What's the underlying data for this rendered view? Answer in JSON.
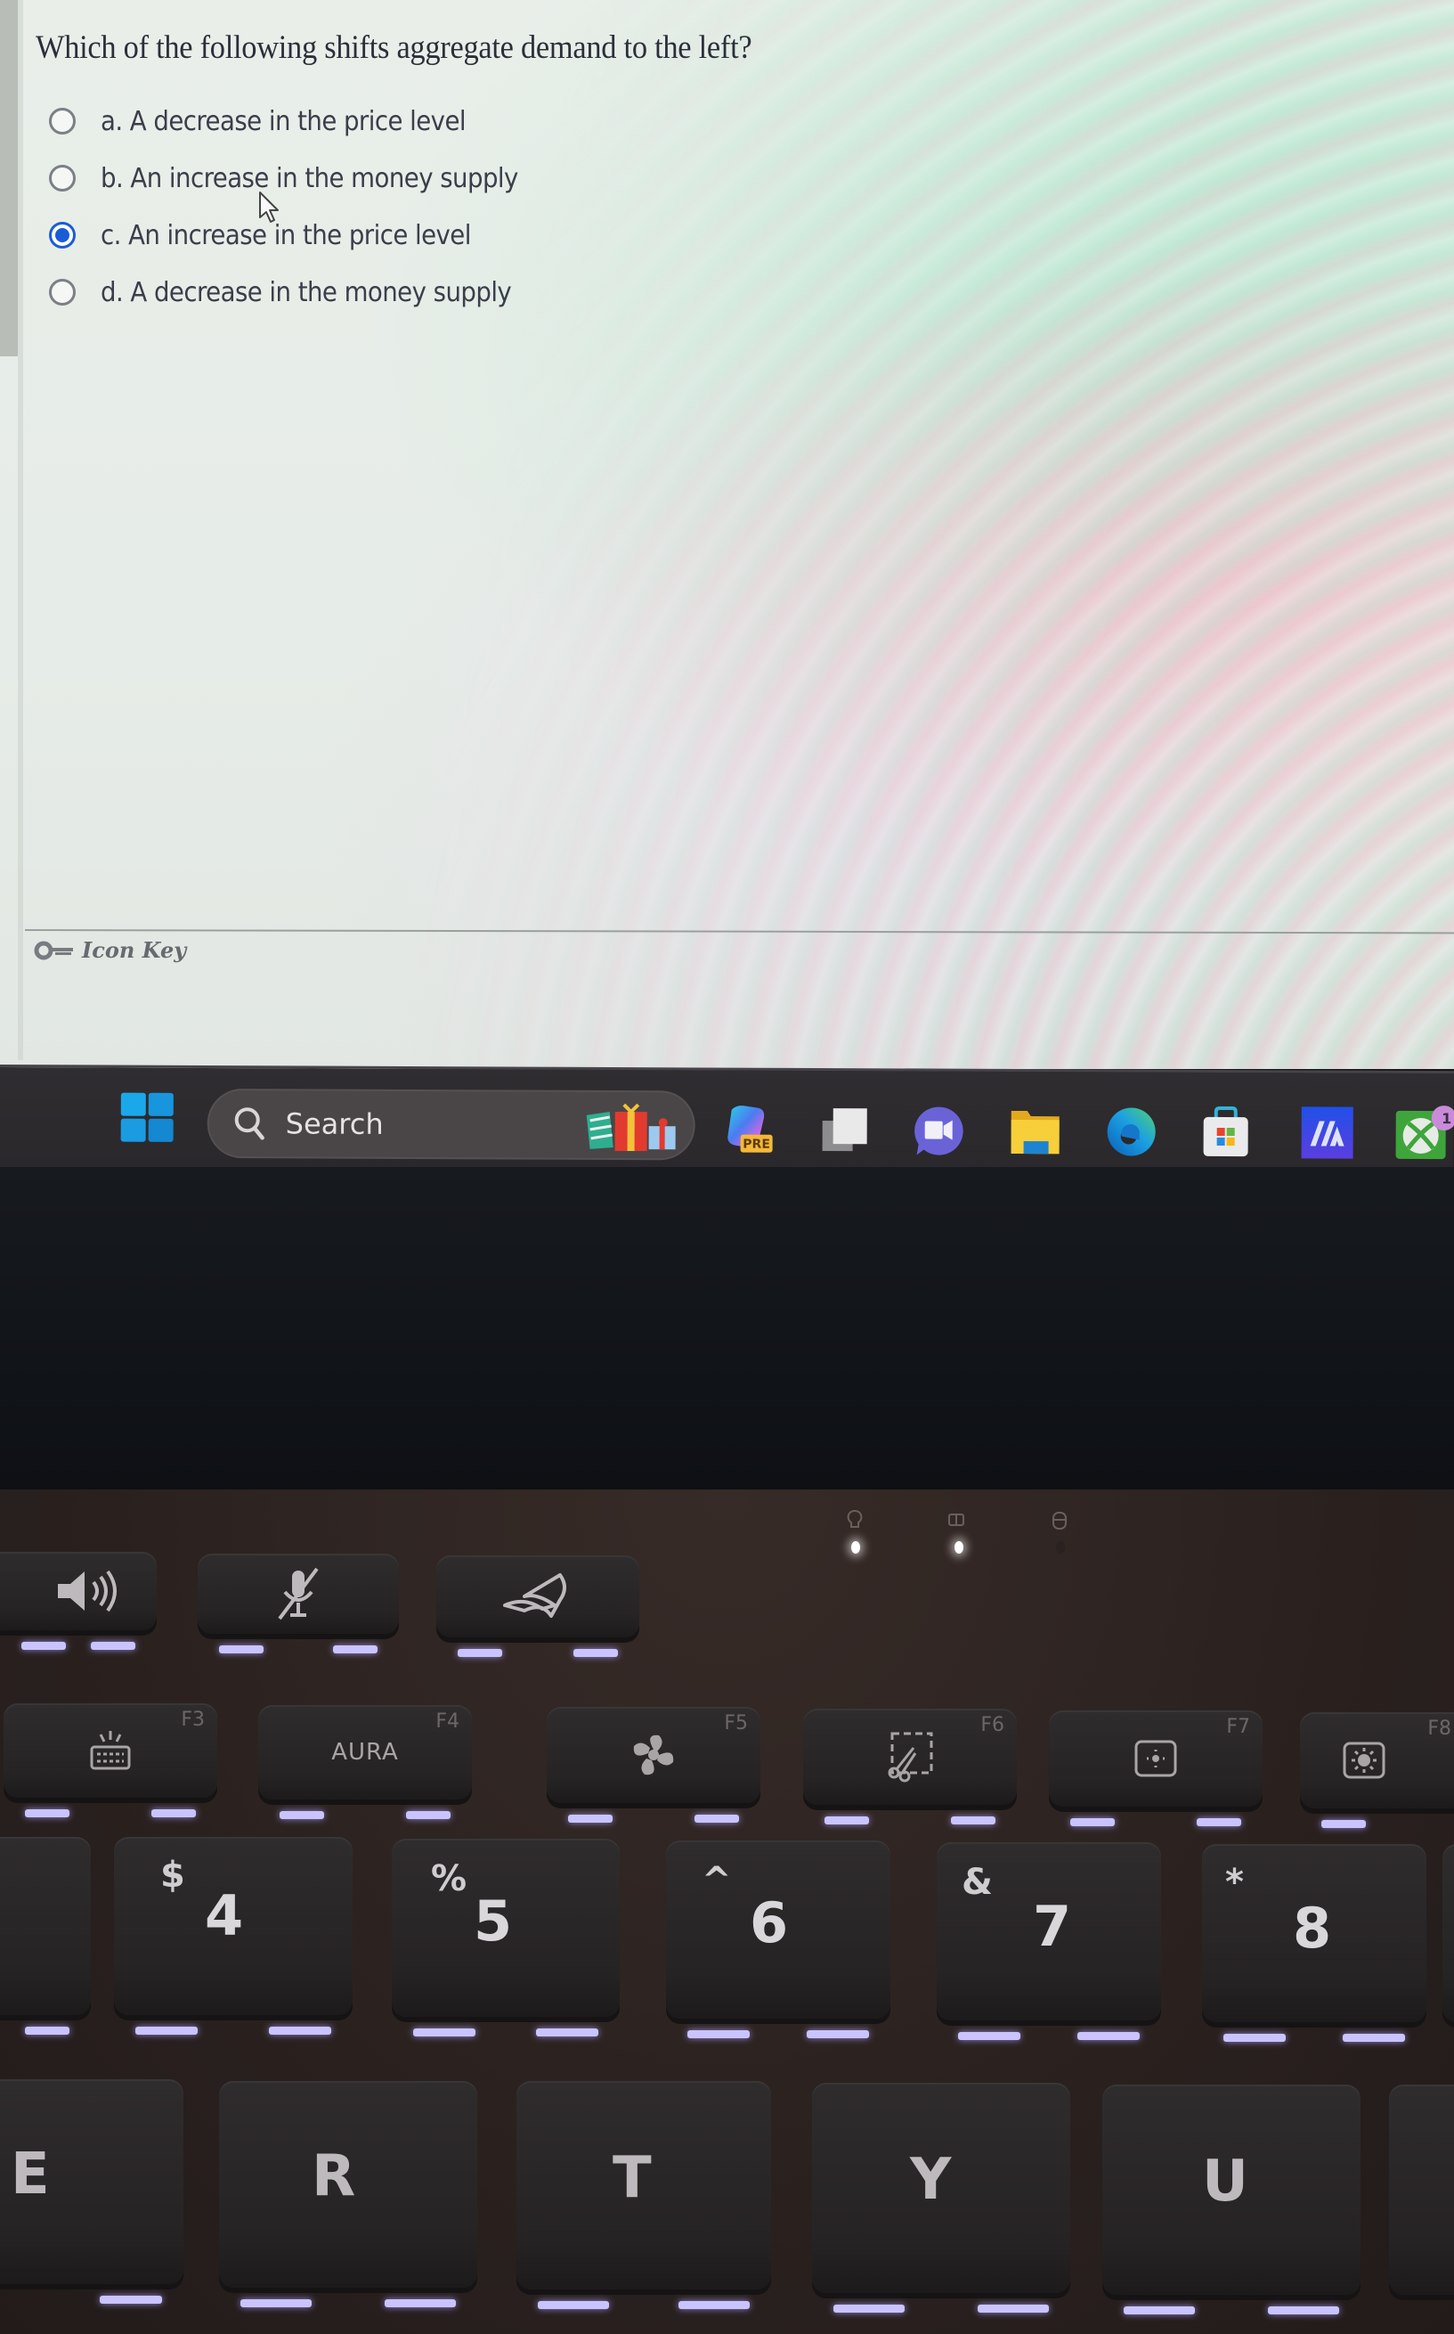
{
  "quiz": {
    "question": "Which of the following shifts aggregate demand to the left?",
    "options": [
      {
        "id": "a",
        "label": "a. A decrease in the price level",
        "selected": false
      },
      {
        "id": "b",
        "label": "b. An increase in the money supply",
        "selected": false
      },
      {
        "id": "c",
        "label": "c. An increase in the price level",
        "selected": true
      },
      {
        "id": "d",
        "label": "d. A decrease in the money supply",
        "selected": false
      }
    ],
    "selected_option": "c",
    "icon_key_label": "Icon Key"
  },
  "taskbar": {
    "start_icon": "windows-start-icon",
    "search_placeholder": "Search",
    "search_icon": "search-icon",
    "search_highlight_icon": "gift-icon",
    "pinned_apps": [
      {
        "name": "copilot-pre",
        "icon": "copilot-icon",
        "badge_text": "PRE"
      },
      {
        "name": "task-view",
        "icon": "task-view-icon"
      },
      {
        "name": "meet",
        "icon": "video-chat-icon"
      },
      {
        "name": "file-explorer",
        "icon": "folder-icon"
      },
      {
        "name": "edge",
        "icon": "edge-browser-icon"
      },
      {
        "name": "microsoft-store",
        "icon": "store-icon"
      },
      {
        "name": "armoury-crate",
        "icon": "ma-app-icon"
      },
      {
        "name": "xbox",
        "icon": "xbox-icon",
        "badge_count": "1"
      }
    ],
    "accent_color": "#1a9ee6"
  },
  "keyboard": {
    "indicator_leds": [
      {
        "icon": "bulb-icon",
        "on": true
      },
      {
        "icon": "airplane-mode-icon",
        "on": true
      },
      {
        "icon": "disk-activity-icon",
        "on": false
      }
    ],
    "top_row": [
      {
        "icon": "volume-icon"
      },
      {
        "icon": "mic-mute-icon"
      },
      {
        "icon": "rog-logo-icon"
      }
    ],
    "function_row": [
      {
        "fn": "F3",
        "icon": "keyboard-backlight-icon"
      },
      {
        "fn": "F4",
        "text": "AURA"
      },
      {
        "fn": "F5",
        "icon": "fan-icon"
      },
      {
        "fn": "F6",
        "icon": "snipping-tool-icon"
      },
      {
        "fn": "F7",
        "icon": "brightness-down-icon"
      },
      {
        "fn": "F8",
        "icon": "brightness-up-icon"
      }
    ],
    "number_row": [
      {
        "shift": "$",
        "main": "4"
      },
      {
        "shift": "%",
        "main": "5"
      },
      {
        "shift": "^",
        "main": "6"
      },
      {
        "shift": "&",
        "main": "7"
      },
      {
        "shift": "*",
        "main": "8"
      }
    ],
    "letter_row": [
      "E",
      "R",
      "T",
      "Y",
      "U"
    ],
    "backlight_color": "#c9c4ff"
  }
}
